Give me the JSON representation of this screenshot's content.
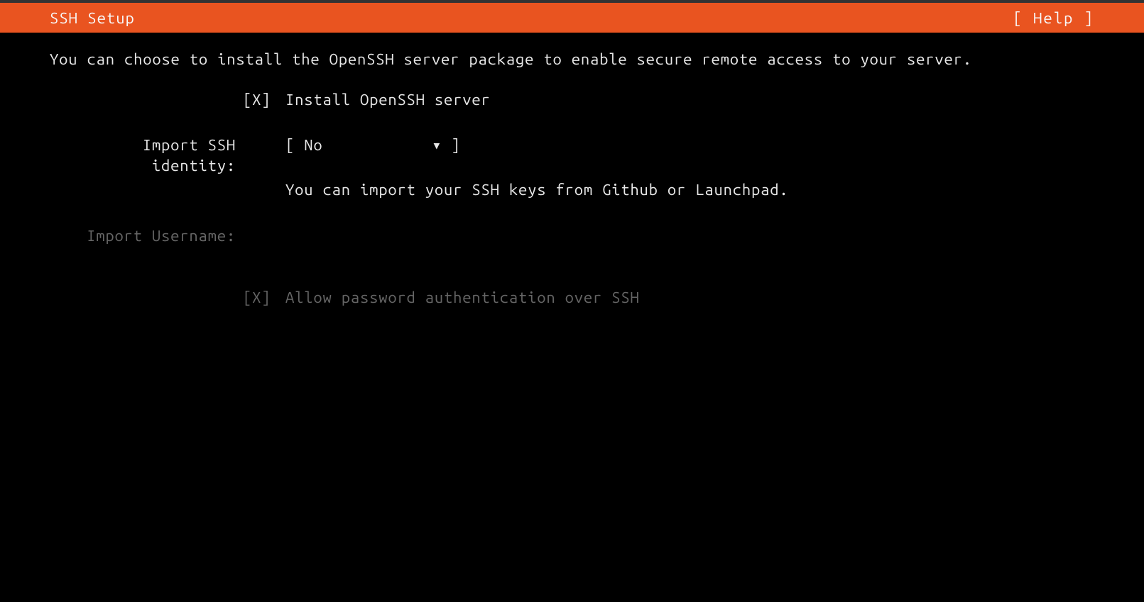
{
  "header": {
    "title": "SSH Setup",
    "help": "[ Help ]"
  },
  "intro": "You can choose to install the OpenSSH server package to enable secure remote access to your server.",
  "install_openssh": {
    "check": "[X]",
    "label": "Install OpenSSH server"
  },
  "import_identity": {
    "label": "Import SSH identity:",
    "dropdown_open": "[ ",
    "dropdown_value": "No",
    "dropdown_arrow": "▾",
    "dropdown_close": " ]",
    "help_text": "You can import your SSH keys from Github or Launchpad."
  },
  "import_username": {
    "label": "Import Username:"
  },
  "allow_password": {
    "check": "[X]",
    "label": "Allow password authentication over SSH"
  }
}
